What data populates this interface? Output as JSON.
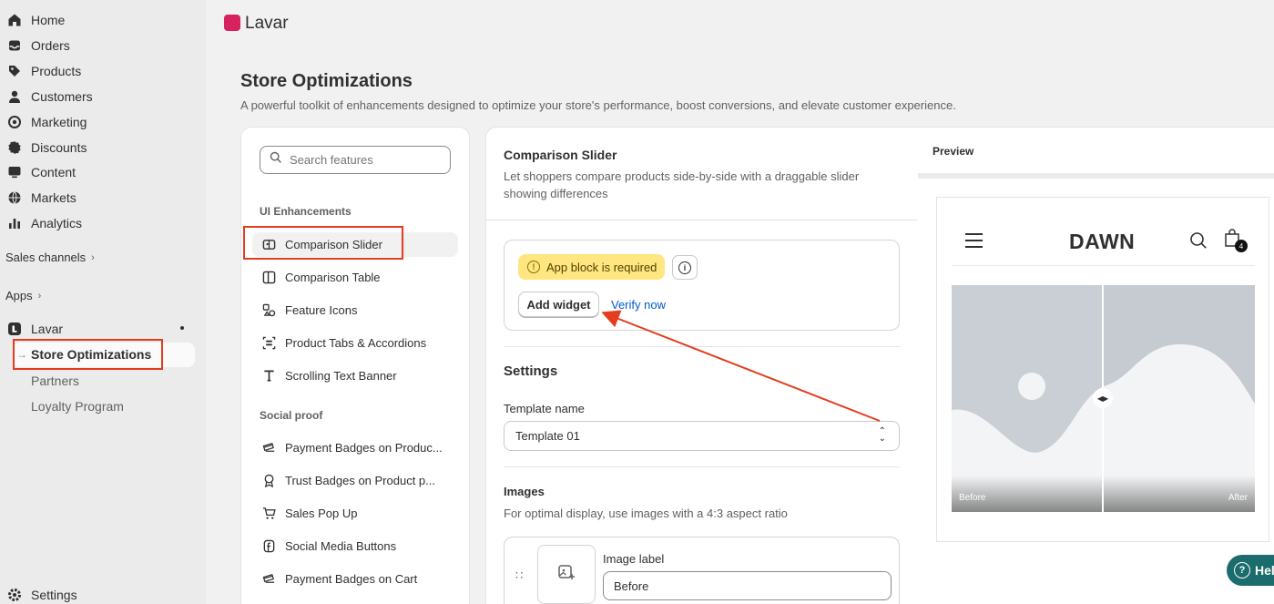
{
  "sidebar": {
    "nav": [
      {
        "label": "Home",
        "icon": "home-icon"
      },
      {
        "label": "Orders",
        "icon": "inbox-icon"
      },
      {
        "label": "Products",
        "icon": "tag-icon"
      },
      {
        "label": "Customers",
        "icon": "person-icon"
      },
      {
        "label": "Marketing",
        "icon": "target-icon"
      },
      {
        "label": "Discounts",
        "icon": "discount-icon"
      },
      {
        "label": "Content",
        "icon": "monitor-icon"
      },
      {
        "label": "Markets",
        "icon": "globe-icon"
      },
      {
        "label": "Analytics",
        "icon": "bar-chart-icon"
      }
    ],
    "sales_channels": "Sales channels",
    "apps": "Apps",
    "app_name": "Lavar",
    "active_item": "Store Optimizations",
    "sub_items": [
      "Partners",
      "Loyalty Program"
    ],
    "settings": "Settings"
  },
  "topbar": {
    "title": "Lavar"
  },
  "page": {
    "title": "Store Optimizations",
    "subtitle": "A powerful toolkit of enhancements designed to optimize your store's performance, boost conversions, and elevate customer experience."
  },
  "features": {
    "search_placeholder": "Search features",
    "ui_group": "UI Enhancements",
    "ui_items": [
      "Comparison Slider",
      "Comparison Table",
      "Feature Icons",
      "Product Tabs & Accordions",
      "Scrolling Text Banner"
    ],
    "social_group": "Social proof",
    "social_items": [
      "Payment Badges on Produc...",
      "Trust Badges on Product p...",
      "Sales Pop Up",
      "Social Media Buttons",
      "Payment Badges on Cart"
    ]
  },
  "detail": {
    "title": "Comparison Slider",
    "description": "Let shoppers compare products side-by-side with a draggable slider showing differences",
    "badge": "App block is required",
    "add_widget": "Add widget",
    "verify": "Verify now",
    "settings_heading": "Settings",
    "template_label": "Template name",
    "template_value": "Template 01",
    "images_heading": "Images",
    "images_hint": "For optimal display, use images with a 4:3 aspect ratio",
    "image_label": "Image label",
    "image_label_value": "Before"
  },
  "preview": {
    "heading": "Preview",
    "store_name": "DAWN",
    "cart_count": "4",
    "before": "Before",
    "after": "After",
    "help": "Hel"
  },
  "colors": {
    "annotation": "#e43c1c",
    "brand": "#d6225e",
    "link": "#005bd3",
    "badge": "#ffe680"
  }
}
